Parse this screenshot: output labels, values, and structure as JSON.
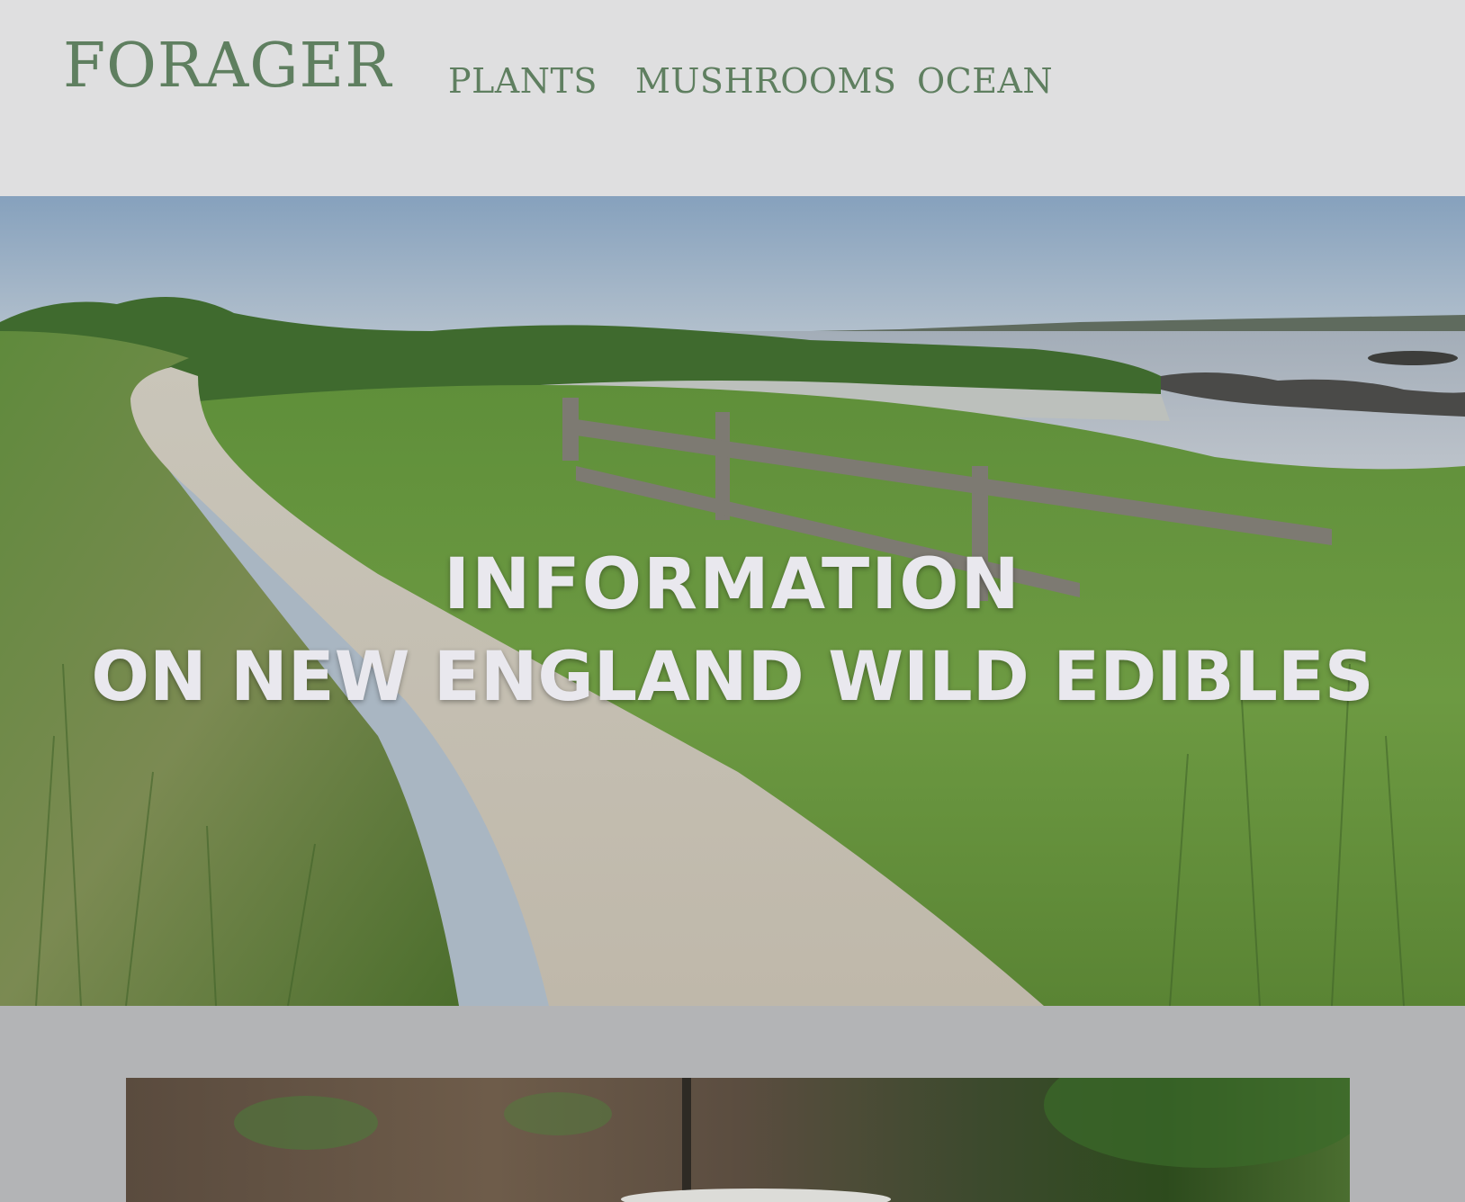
{
  "site": {
    "logo": "FORAGER"
  },
  "nav": {
    "items": [
      {
        "label": "PLANTS"
      },
      {
        "label": "MUSHROOMS"
      },
      {
        "label": "OCEAN"
      }
    ]
  },
  "hero": {
    "title_line1": "INFORMATION",
    "title_line2": "ON NEW ENGLAND WILD EDIBLES",
    "image": "coastal-trail-photo"
  },
  "feature": {
    "image": "wild-plant-photo"
  },
  "colors": {
    "header_bg": "#dfdfe0",
    "brand_green": "#5f7f60",
    "page_bg": "#b3b4b6",
    "hero_text": "#e9e8ee"
  }
}
